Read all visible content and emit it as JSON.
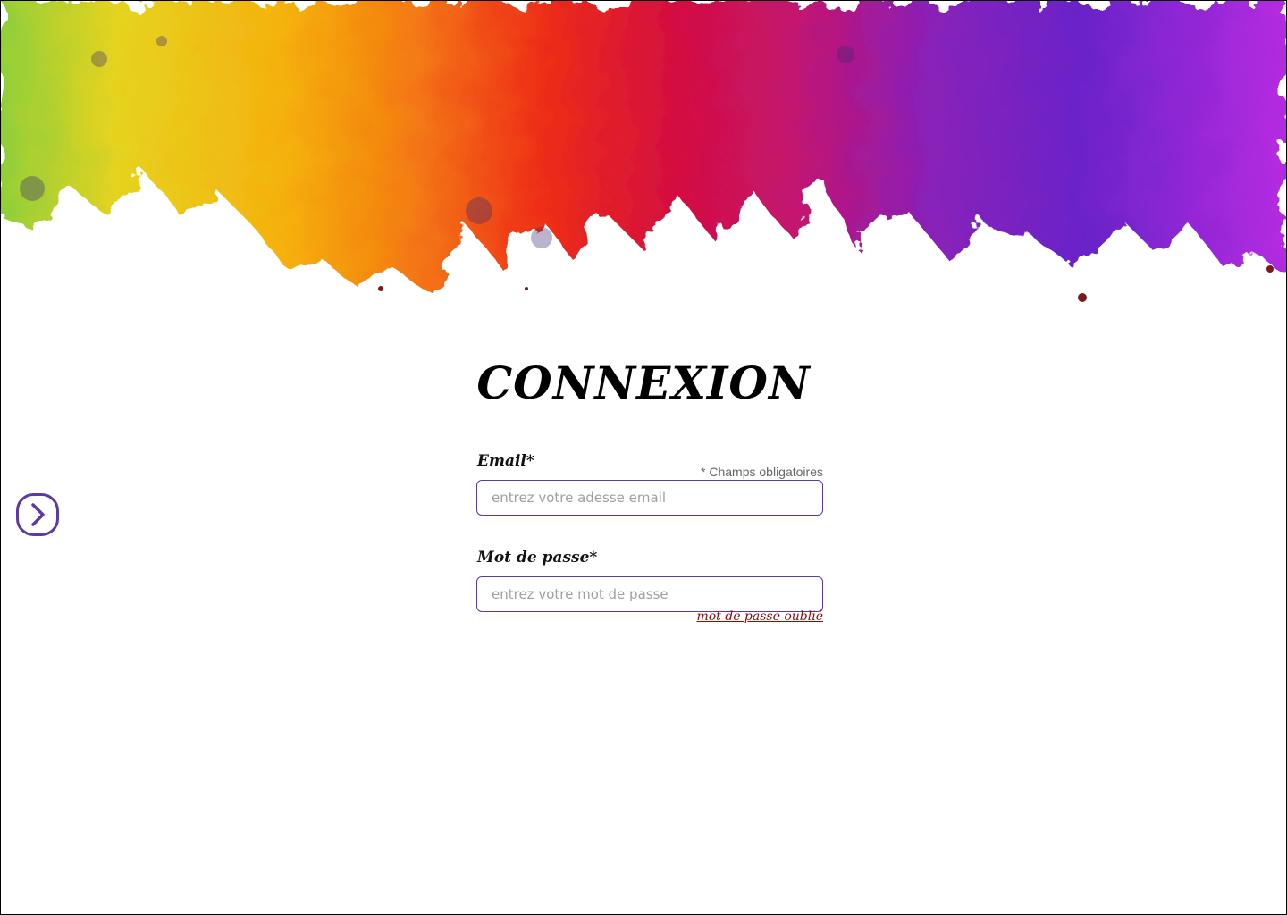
{
  "header": {
    "title": "CONNEXION"
  },
  "form": {
    "required_note": "* Champs obligatoires",
    "email": {
      "label": "Email*",
      "placeholder": "entrez votre adesse email",
      "value": ""
    },
    "password": {
      "label": "Mot de passe*",
      "placeholder": "entrez votre mot de passe",
      "value": ""
    },
    "forgot_link": "mot de passe oublié"
  },
  "navigation": {
    "next_icon": "chevron-right-icon"
  },
  "colors": {
    "accent": "#5b3aa8",
    "link": "#8b0a0a"
  }
}
